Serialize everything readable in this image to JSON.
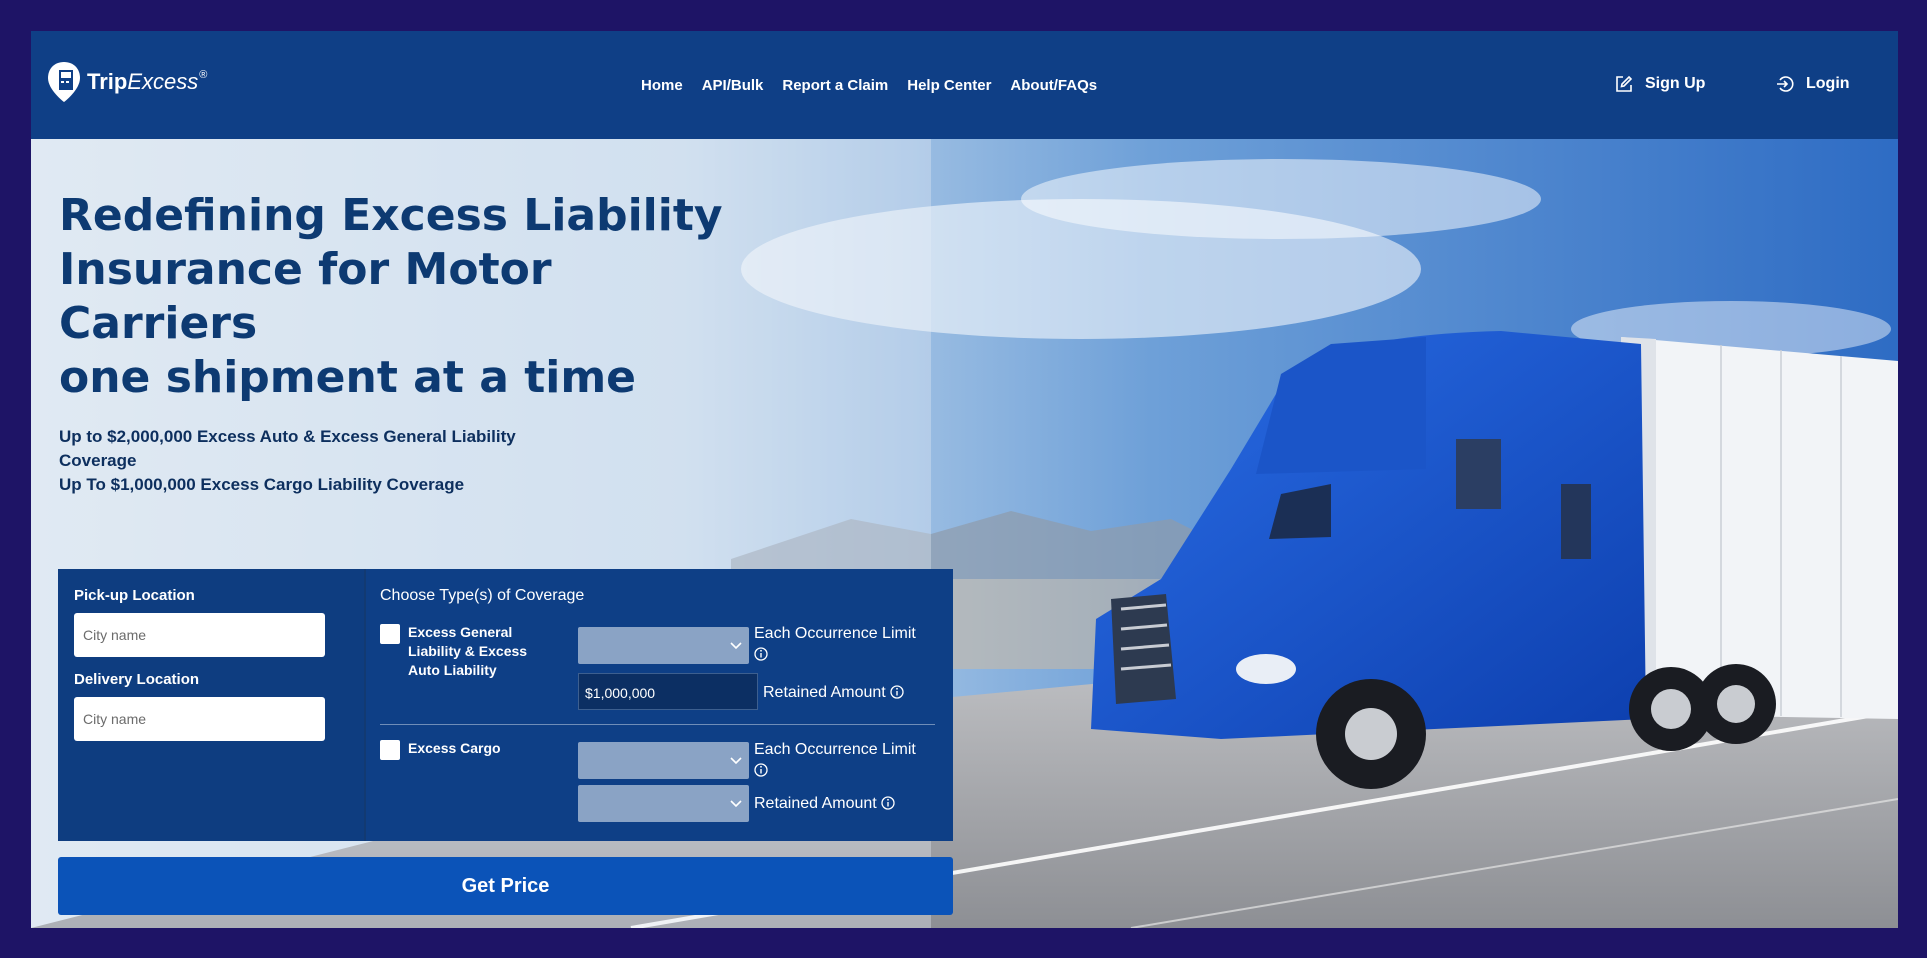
{
  "brand": {
    "trip": "Trip",
    "excess": "Excess",
    "reg": "®"
  },
  "nav": [
    {
      "label": "Home"
    },
    {
      "label": "API/Bulk"
    },
    {
      "label": "Report a Claim"
    },
    {
      "label": "Help Center"
    },
    {
      "label": "About/FAQs"
    }
  ],
  "auth": {
    "signup": "Sign Up",
    "login": "Login"
  },
  "hero": {
    "headline_1": "Redefining Excess Liability",
    "headline_2": "Insurance for Motor",
    "headline_3": "Carriers",
    "headline_4": "one shipment at a time",
    "sub_1": "Up to $2,000,000 Excess Auto & Excess General Liability Coverage",
    "sub_2": "Up To $1,000,000 Excess Cargo Liability Coverage"
  },
  "form": {
    "pickup_label": "Pick-up Location",
    "pickup_placeholder": "City name",
    "delivery_label": "Delivery Location",
    "delivery_placeholder": "City name",
    "coverage_title": "Choose Type(s) of Coverage",
    "general": {
      "label": "Excess General Liability & Excess Auto Liability",
      "occurrence_label": "Each Occurrence Limit",
      "retained_label": "Retained Amount",
      "retained_value": "$1,000,000"
    },
    "cargo": {
      "label": "Excess Cargo",
      "occurrence_label": "Each Occurrence Limit",
      "retained_label": "Retained Amount"
    },
    "submit": "Get Price"
  },
  "colors": {
    "frame_border": "#1e1466",
    "topbar": "#0f3f86",
    "headline": "#0d3a72",
    "button": "#0b53b8",
    "truck": "#1d5fd6"
  },
  "icons": [
    "logo-icon",
    "edit-icon",
    "login-icon",
    "info-icon",
    "chevron-down-icon"
  ]
}
